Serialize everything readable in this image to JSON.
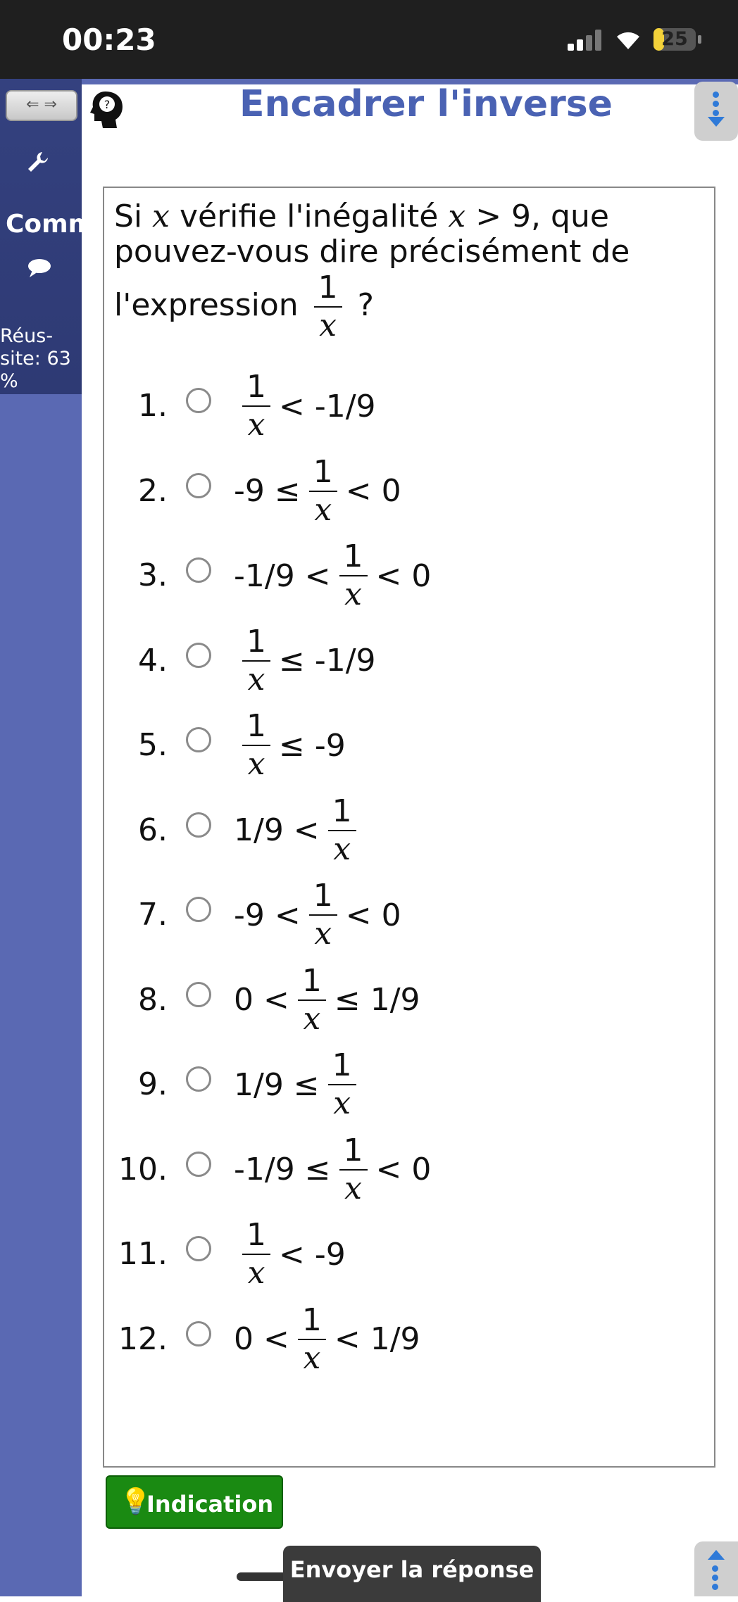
{
  "status": {
    "time": "00:23",
    "battery": "25",
    "battery_fraction": 0.25
  },
  "sidebar": {
    "nav_arrows": "⇐ ⇒",
    "comm_label": "Comm",
    "success_label": "Réus-site: 63 %"
  },
  "header": {
    "title": "Encadrer l'inverse"
  },
  "question": {
    "text_prefix": "Si",
    "var": "x",
    "text_mid": "vérifie l'inégalité",
    "var2": "x",
    "text_cond": "> 9, que pouvez-vous dire précisément de l'expression",
    "frac_num": "1",
    "frac_den": "x",
    "text_end": "?"
  },
  "options": [
    {
      "num": "1.",
      "before": "",
      "after": "< -1/9"
    },
    {
      "num": "2.",
      "before": "-9 ≤",
      "after": "< 0"
    },
    {
      "num": "3.",
      "before": "-1/9 <",
      "after": "< 0"
    },
    {
      "num": "4.",
      "before": "",
      "after": "≤ -1/9"
    },
    {
      "num": "5.",
      "before": "",
      "after": "≤ -9"
    },
    {
      "num": "6.",
      "before": "1/9 <",
      "after": ""
    },
    {
      "num": "7.",
      "before": "-9 <",
      "after": "< 0"
    },
    {
      "num": "8.",
      "before": "0 <",
      "after": "≤ 1/9"
    },
    {
      "num": "9.",
      "before": "1/9 ≤",
      "after": ""
    },
    {
      "num": "10.",
      "before": "-1/9 ≤",
      "after": "< 0"
    },
    {
      "num": "11.",
      "before": "",
      "after": "< -9"
    },
    {
      "num": "12.",
      "before": "0 <",
      "after": "< 1/9"
    }
  ],
  "buttons": {
    "hint": "Indication",
    "send": "Envoyer la réponse"
  },
  "colors": {
    "sidebar": "#5a69b3",
    "title": "#4a62b3",
    "hint_green": "#1a8a12"
  }
}
